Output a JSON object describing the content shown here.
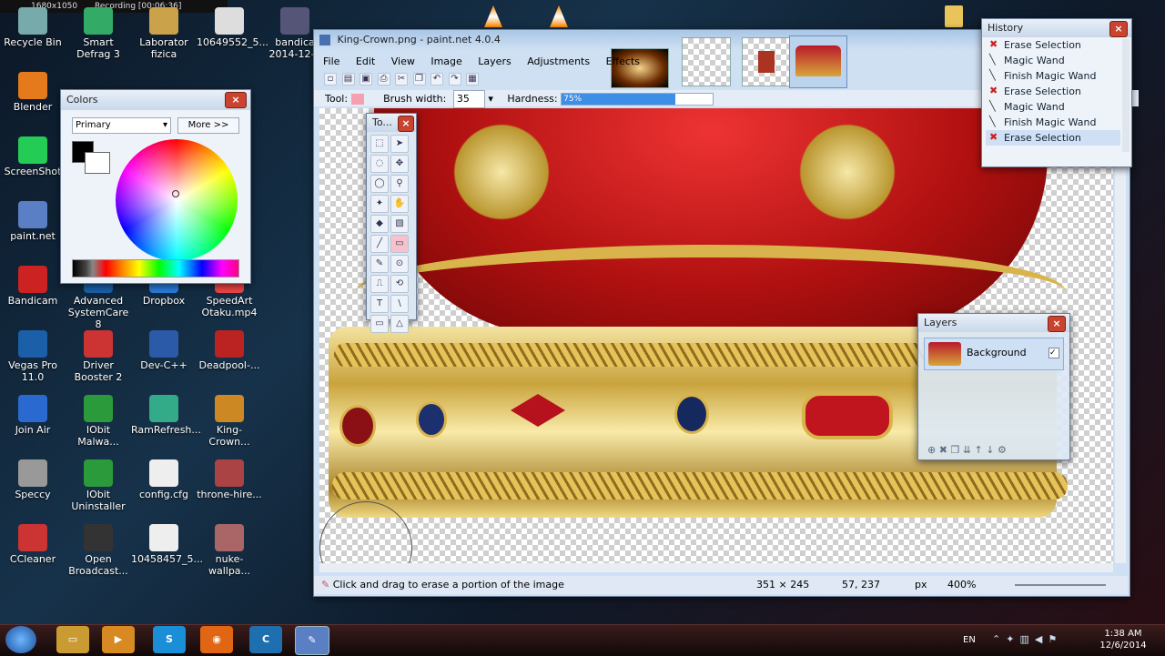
{
  "recording_bar": {
    "resolution": "1680x1050",
    "status": "Recording [00:06:36]"
  },
  "desktop_icons": [
    {
      "label": "Recycle Bin"
    },
    {
      "label": "Smart Defrag 3"
    },
    {
      "label": "Laborator fizica"
    },
    {
      "label": "10649552_5..."
    },
    {
      "label": "bandica 2014-12-0"
    },
    {
      "label": "Blender"
    },
    {
      "label": "ScreenShot"
    },
    {
      "label": "paint.net"
    },
    {
      "label": "Bandicam"
    },
    {
      "label": "Advanced SystemCare 8"
    },
    {
      "label": "Dropbox"
    },
    {
      "label": "SpeedArt Otaku.mp4"
    },
    {
      "label": "Vegas Pro 11.0"
    },
    {
      "label": "Driver Booster 2"
    },
    {
      "label": "Dev-C++"
    },
    {
      "label": "Deadpool-..."
    },
    {
      "label": "Join Air"
    },
    {
      "label": "IObit Malwa..."
    },
    {
      "label": "RamRefresh..."
    },
    {
      "label": "King-Crown..."
    },
    {
      "label": "Speccy"
    },
    {
      "label": "IObit Uninstaller"
    },
    {
      "label": "config.cfg"
    },
    {
      "label": "throne-hire..."
    },
    {
      "label": "CCleaner"
    },
    {
      "label": "Open Broadcast..."
    },
    {
      "label": "10458457_5..."
    },
    {
      "label": "nuke-wallpa..."
    }
  ],
  "colors_window": {
    "title": "Colors",
    "mode": "Primary",
    "more_button": "More >>"
  },
  "paintnet": {
    "title": "King-Crown.png - paint.net 4.0.4",
    "menu": [
      "File",
      "Edit",
      "View",
      "Image",
      "Layers",
      "Adjustments",
      "Effects"
    ],
    "toolbar": {
      "tool_label": "Tool:",
      "brush_width_label": "Brush width:",
      "brush_width": "35",
      "hardness_label": "Hardness:",
      "hardness": "75%",
      "hardness_value": 0.75
    },
    "tools_title": "To...",
    "status": {
      "hint": "Click and drag to erase a portion of the image",
      "size": "351 × 245",
      "coords": "57, 237",
      "unit": "px",
      "zoom": "400%"
    }
  },
  "history_window": {
    "title": "History",
    "items": [
      {
        "label": "Erase Selection",
        "icon": "erase-icon"
      },
      {
        "label": "Magic Wand",
        "icon": "magic-wand-icon"
      },
      {
        "label": "Finish Magic Wand",
        "icon": "magic-wand-icon"
      },
      {
        "label": "Erase Selection",
        "icon": "erase-icon"
      },
      {
        "label": "Magic Wand",
        "icon": "magic-wand-icon"
      },
      {
        "label": "Finish Magic Wand",
        "icon": "magic-wand-icon"
      },
      {
        "label": "Erase Selection",
        "icon": "erase-icon"
      }
    ]
  },
  "layers_window": {
    "title": "Layers",
    "layer_name": "Background"
  },
  "taskbar": {
    "lang": "EN",
    "time": "1:38 AM",
    "date": "12/6/2014"
  }
}
